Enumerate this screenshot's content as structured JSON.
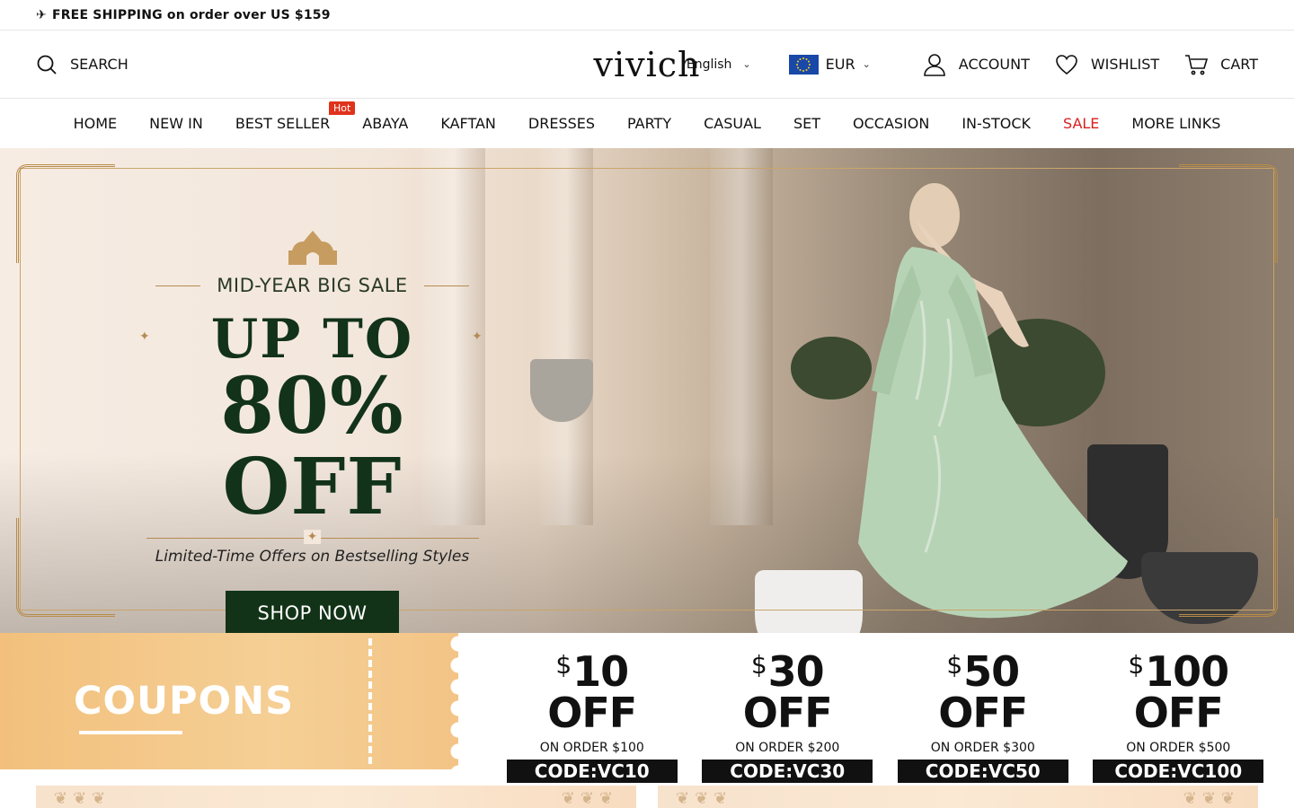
{
  "announcement": {
    "icon": "airplane-icon",
    "text": "FREE SHIPPING on order over US $159"
  },
  "header": {
    "search_label": "SEARCH",
    "logo": "vivich",
    "language": "English",
    "currency": "EUR",
    "account_label": "ACCOUNT",
    "wishlist_label": "WISHLIST",
    "cart_label": "CART"
  },
  "nav": {
    "items": [
      {
        "label": "HOME"
      },
      {
        "label": "NEW IN"
      },
      {
        "label": "BEST SELLER",
        "badge": "Hot"
      },
      {
        "label": "ABAYA"
      },
      {
        "label": "KAFTAN"
      },
      {
        "label": "DRESSES"
      },
      {
        "label": "PARTY"
      },
      {
        "label": "CASUAL"
      },
      {
        "label": "SET"
      },
      {
        "label": "OCCASION"
      },
      {
        "label": "IN-STOCK"
      },
      {
        "label": "SALE"
      },
      {
        "label": "MORE LINKS"
      }
    ],
    "sale_color": "#d91f1f"
  },
  "hero": {
    "subhead": "MID-YEAR BIG SALE",
    "headline_line1": "UP TO",
    "headline_line2": "80% OFF",
    "tagline": "Limited-Time Offers on Bestselling Styles",
    "cta": "SHOP NOW",
    "accent": "#123317"
  },
  "coupons": {
    "title": "COUPONS",
    "items": [
      {
        "currency": "$",
        "amount": "10 OFF",
        "condition": "ON ORDER $100",
        "code": "CODE:VC10"
      },
      {
        "currency": "$",
        "amount": "30 OFF",
        "condition": "ON ORDER $200",
        "code": "CODE:VC30"
      },
      {
        "currency": "$",
        "amount": "50 OFF",
        "condition": "ON ORDER $300",
        "code": "CODE:VC50"
      },
      {
        "currency": "$",
        "amount": "100 OFF",
        "condition": "ON ORDER $500",
        "code": "CODE:VC100"
      }
    ]
  }
}
